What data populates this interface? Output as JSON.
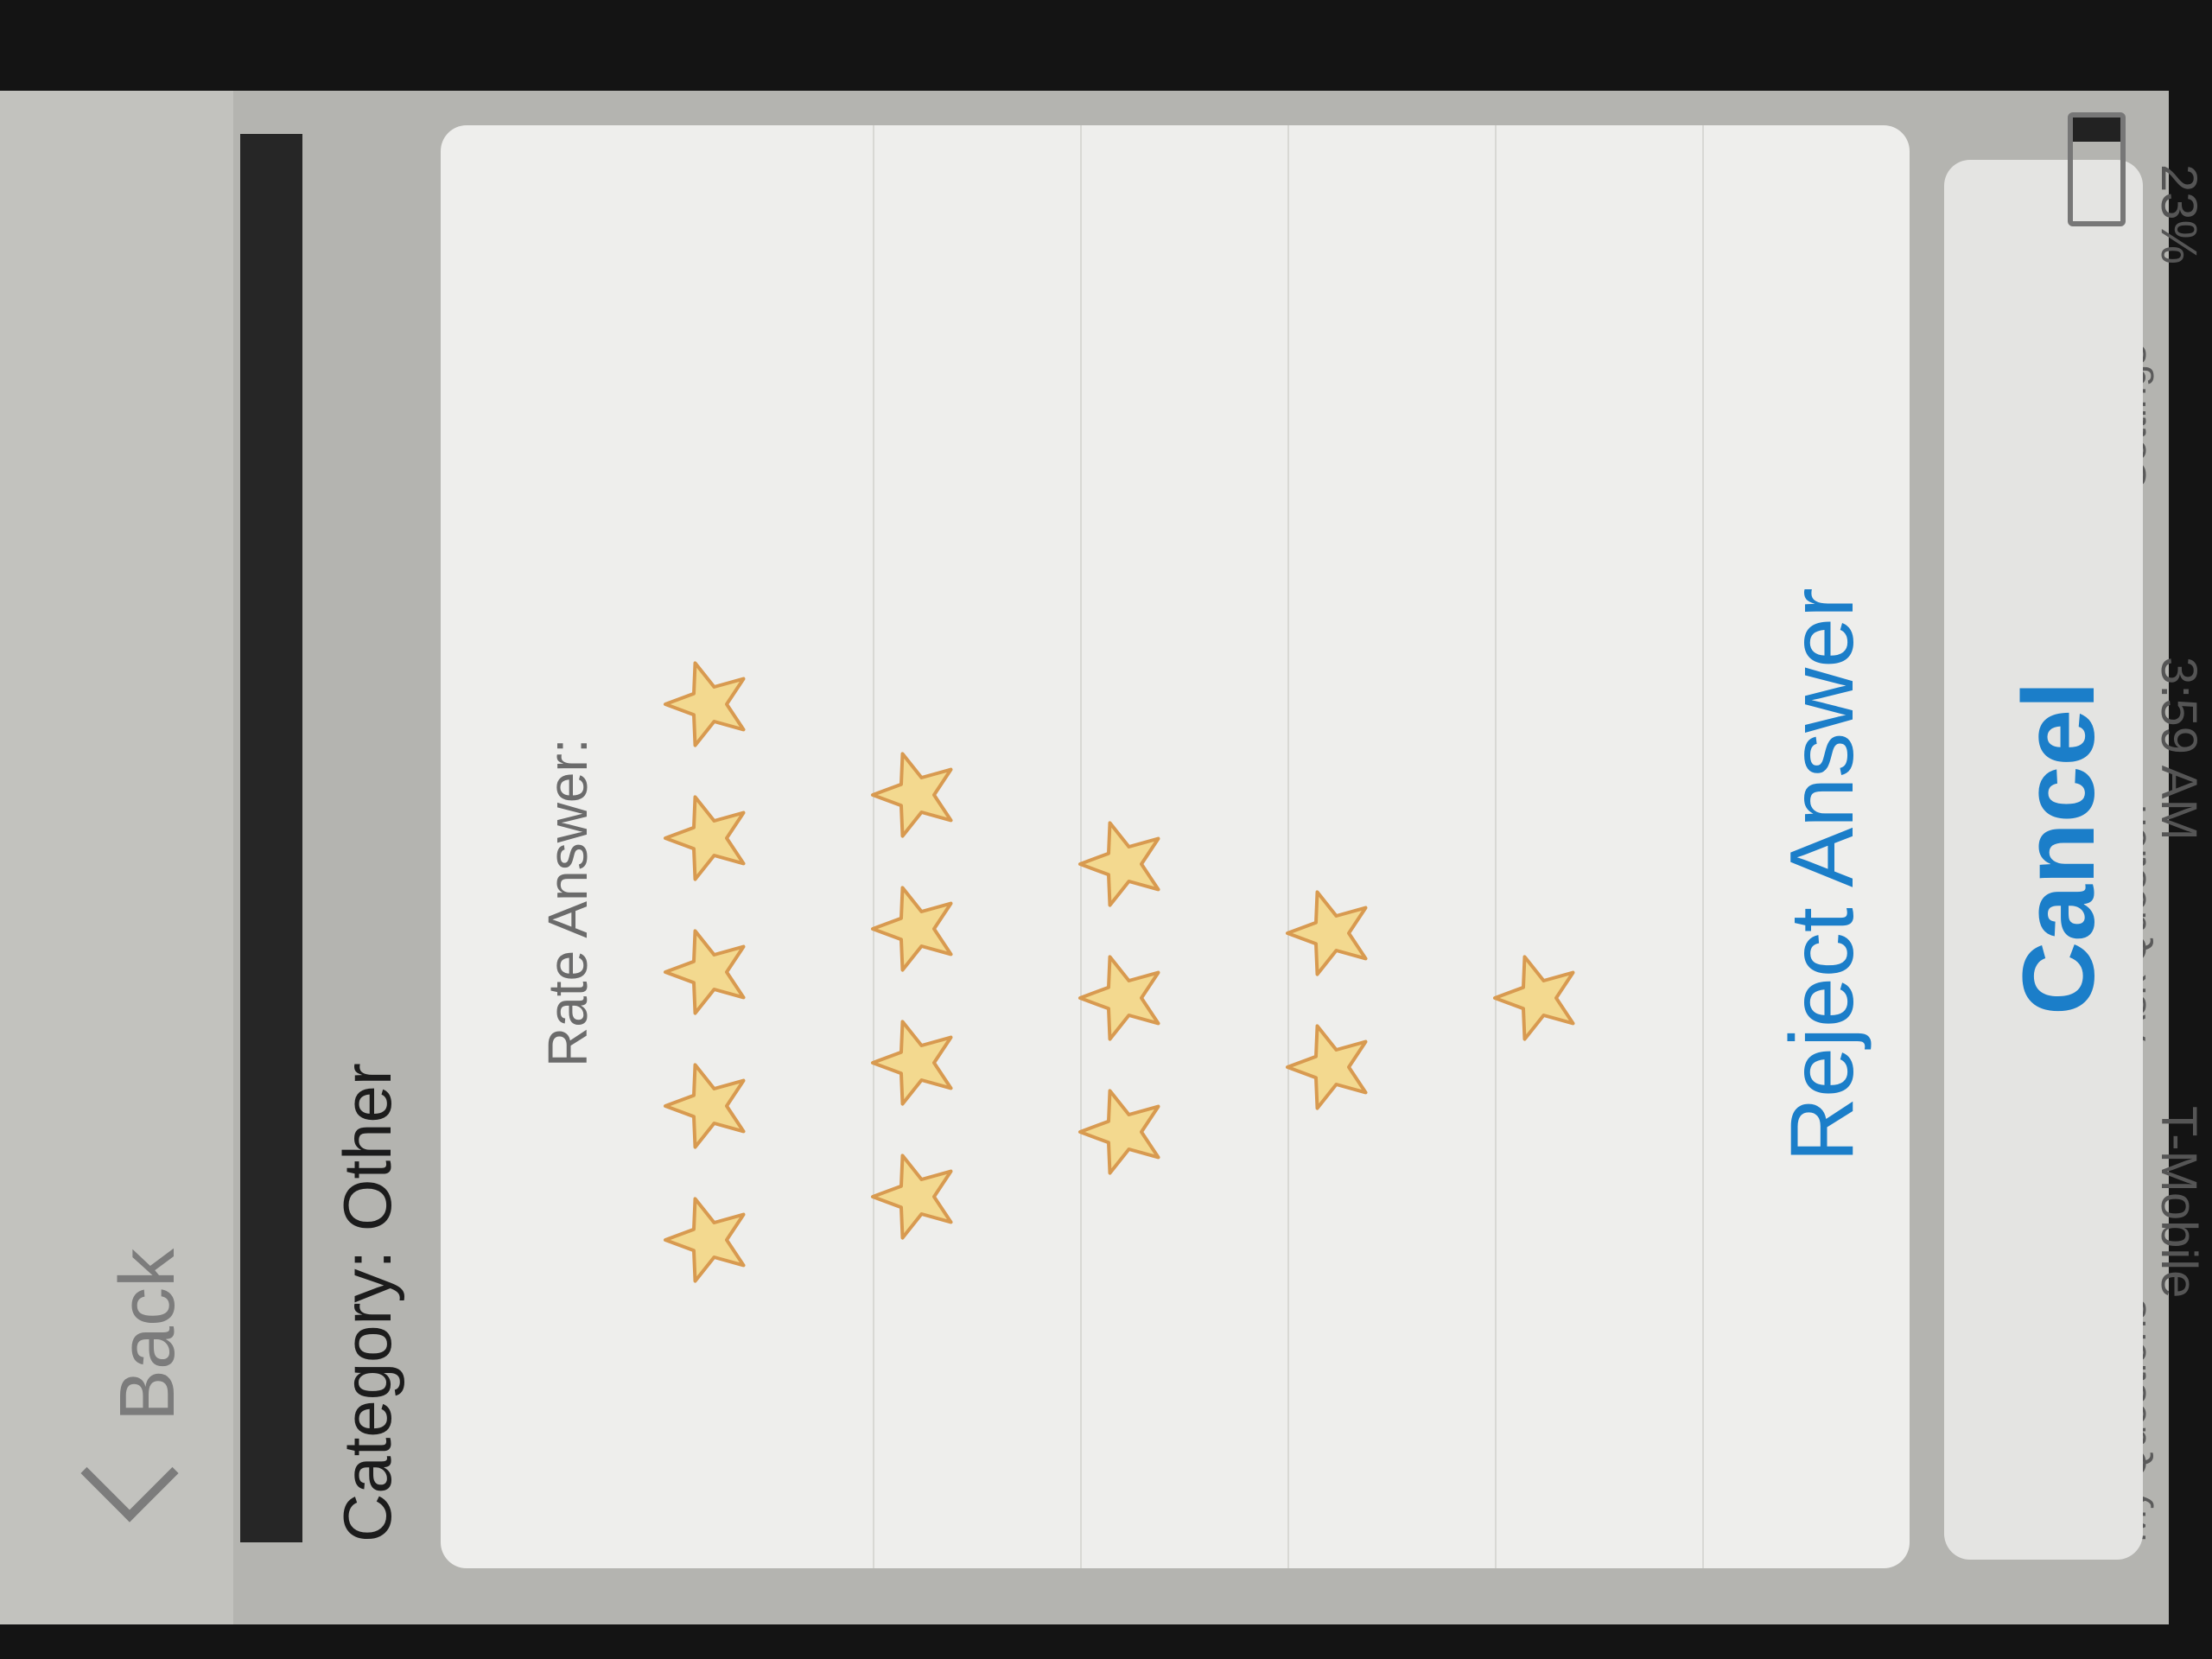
{
  "status_bar": {
    "carrier": "T-Mobile",
    "time": "3:59 AM",
    "battery_percent": "23%",
    "battery_level": 0.23
  },
  "nav": {
    "back_label": "Back",
    "category_text": "Category: Other"
  },
  "action_sheet": {
    "title": "Rate Answer:",
    "rating_options": [
      {
        "stars": 5
      },
      {
        "stars": 4
      },
      {
        "stars": 3
      },
      {
        "stars": 2
      },
      {
        "stars": 1
      }
    ],
    "reject_label": "Reject Answer",
    "cancel_label": "Cancel"
  },
  "tab_bar": {
    "items": [
      "My Questions",
      "Ask Question",
      "Settings"
    ]
  },
  "colors": {
    "accent": "#1b7ec9",
    "star_fill": "#f3d98f",
    "star_stroke": "#d89a50"
  }
}
